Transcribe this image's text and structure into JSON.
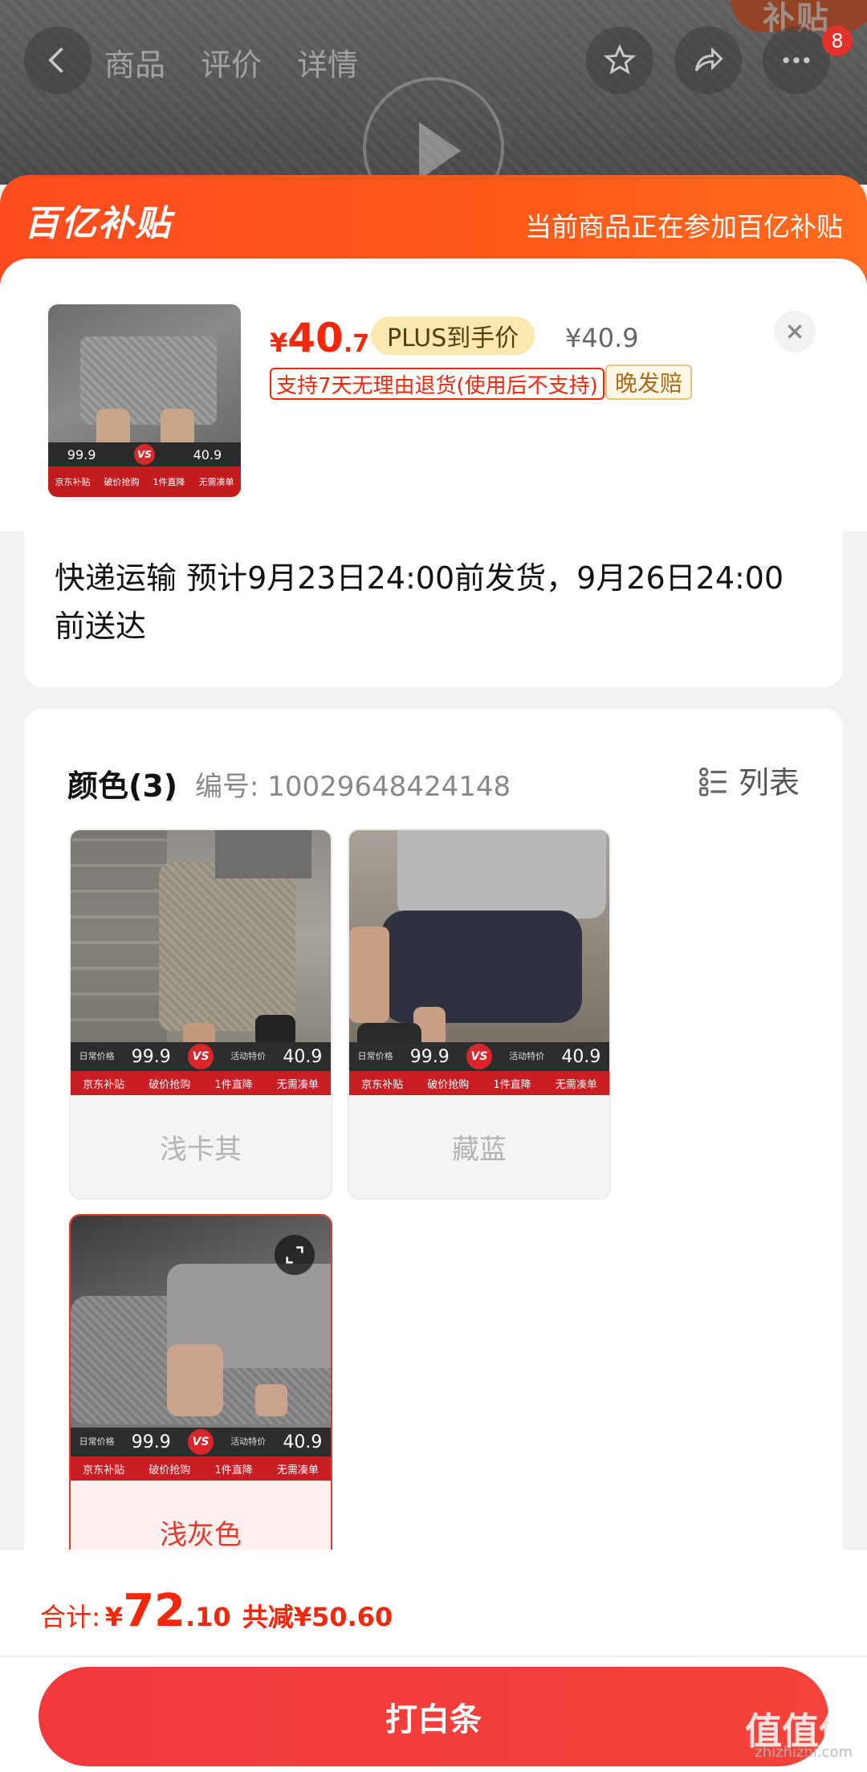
{
  "background": {
    "nav_tabs": [
      "商品",
      "评价",
      "详情"
    ],
    "badge_text": "补贴",
    "cart_count": "8"
  },
  "banner": {
    "logo": "百亿补贴",
    "note": "当前商品正在参加百亿补贴"
  },
  "product": {
    "price_yen": "¥",
    "price_int": "40",
    "price_dec": ".7",
    "plus_tag": "PLUS到手价",
    "original_price": "¥40.9",
    "return_tag": "支持7天无理由退货(使用后不支持)",
    "late_tag": "晚发赔",
    "thumb_strip": {
      "left_label": "日常价格",
      "left_price": "99.9",
      "vs": "VS",
      "right_label": "活动特价",
      "right_price": "40.9",
      "slogans": [
        "京东补贴",
        "破价抢购",
        "1件直降",
        "无需凑单"
      ]
    }
  },
  "shipping": {
    "text": "快递运输 预计9月23日24:00前发货，9月26日24:00前送达"
  },
  "spec": {
    "title": "颜色(3)",
    "code": "编号: 10029648424148",
    "list_toggle": "列表",
    "variants": [
      {
        "label": "浅卡其",
        "selected": false
      },
      {
        "label": "藏蓝",
        "selected": false
      },
      {
        "label": "浅灰色",
        "selected": true
      }
    ],
    "strip": {
      "left_label": "日常价格",
      "yen": "¥",
      "left_price": "99.9",
      "vs": "VS",
      "right_label": "活动特价",
      "right_price": "40.9",
      "slogans": [
        "京东补贴",
        "破价抢购",
        "1件直降",
        "无需凑单"
      ]
    }
  },
  "bottom": {
    "total_label": "合计:",
    "total_yen": "¥",
    "total_int": "72",
    "total_dec": ".10",
    "saved": "共减¥50.60",
    "pay_button": "打白条"
  },
  "watermark": {
    "text": "值值值",
    "site": "zhizhizhi.com"
  }
}
